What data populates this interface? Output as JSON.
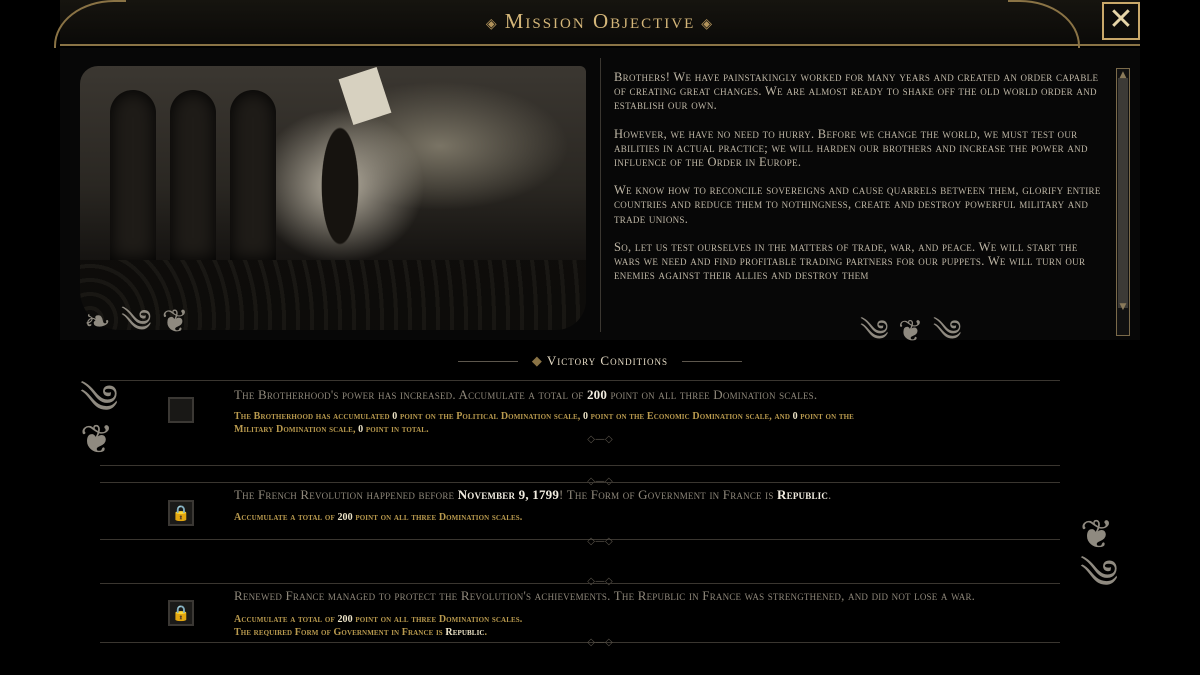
{
  "header": {
    "title": "Mission Objective",
    "close_label": "✕"
  },
  "story": {
    "paragraphs": [
      "Brothers! We have painstakingly worked for many years and created an order capable of creating great changes. We are almost ready to shake off the old world order and establish our own.",
      "However, we have no need to hurry. Before we change the world, we must test our abilities in actual practice; we will harden our brothers and increase the power and influence of the Order in Europe.",
      "We know how to reconcile sovereigns and cause quarrels between them, glorify entire countries and reduce them to nothingness, create and destroy powerful military and trade unions.",
      "So, let us test ourselves in the matters of trade, war, and peace. We will start the wars we need and find profitable trading partners for our puppets. We will turn our enemies against their allies and destroy them"
    ]
  },
  "victory": {
    "title": "Victory Conditions",
    "conditions": [
      {
        "state": "unchecked",
        "main_a": "The Brotherhood's power has increased. Accumulate a total of ",
        "main_b": "200",
        "main_c": " point on all three Domination scales.",
        "sub1_a": "The Brotherhood has accumulated ",
        "sub1_v1": "0",
        "sub1_b": " point on the Political Domination scale, ",
        "sub1_v2": "0",
        "sub1_c": " point on the Economic Domination scale, and ",
        "sub1_v3": "0",
        "sub1_d": " point on the",
        "sub2_a": "Military Domination scale, ",
        "sub2_v": "0",
        "sub2_b": " point in total."
      },
      {
        "state": "locked",
        "main_a": "The French Revolution happened before ",
        "main_b": "November 9, 1799",
        "main_c": "! The Form of Government in France is ",
        "main_d": "Republic",
        "main_e": ".",
        "sub_a": "Accumulate a total of ",
        "sub_v": "200",
        "sub_b": " point on all three Domination scales."
      },
      {
        "state": "locked",
        "main": "Renewed France managed to protect the Revolution's achievements. The Republic in France was strengthened, and did not lose a war.",
        "sub1_a": "Accumulate a total of ",
        "sub1_v": "200",
        "sub1_b": " point on all three Domination scales.",
        "sub2_a": "The required Form of Government in France is ",
        "sub2_v": "Republic",
        "sub2_b": "."
      }
    ]
  },
  "icons": {
    "close": "close-icon",
    "lock": "lock-icon"
  },
  "colors": {
    "gold": "#b99a4e",
    "frame": "#8a7345"
  }
}
